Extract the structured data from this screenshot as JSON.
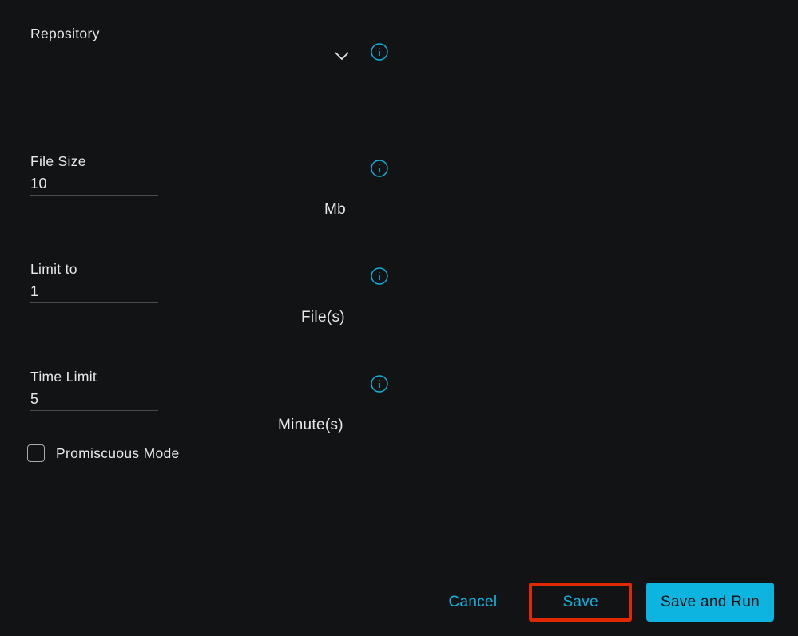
{
  "colors": {
    "accent": "#0db4e0",
    "highlight_border": "#e02801",
    "background": "#111315"
  },
  "fields": {
    "repository": {
      "label": "Repository",
      "value": ""
    },
    "file_size": {
      "label": "File Size",
      "value": "10",
      "unit": "Mb"
    },
    "limit_to": {
      "label": "Limit to",
      "value": "1",
      "unit": "File(s)"
    },
    "time_limit": {
      "label": "Time Limit",
      "value": "5",
      "unit": "Minute(s)"
    },
    "promiscuous": {
      "label": "Promiscuous Mode",
      "checked": false
    }
  },
  "buttons": {
    "cancel": "Cancel",
    "save": "Save",
    "save_and_run": "Save and Run"
  }
}
